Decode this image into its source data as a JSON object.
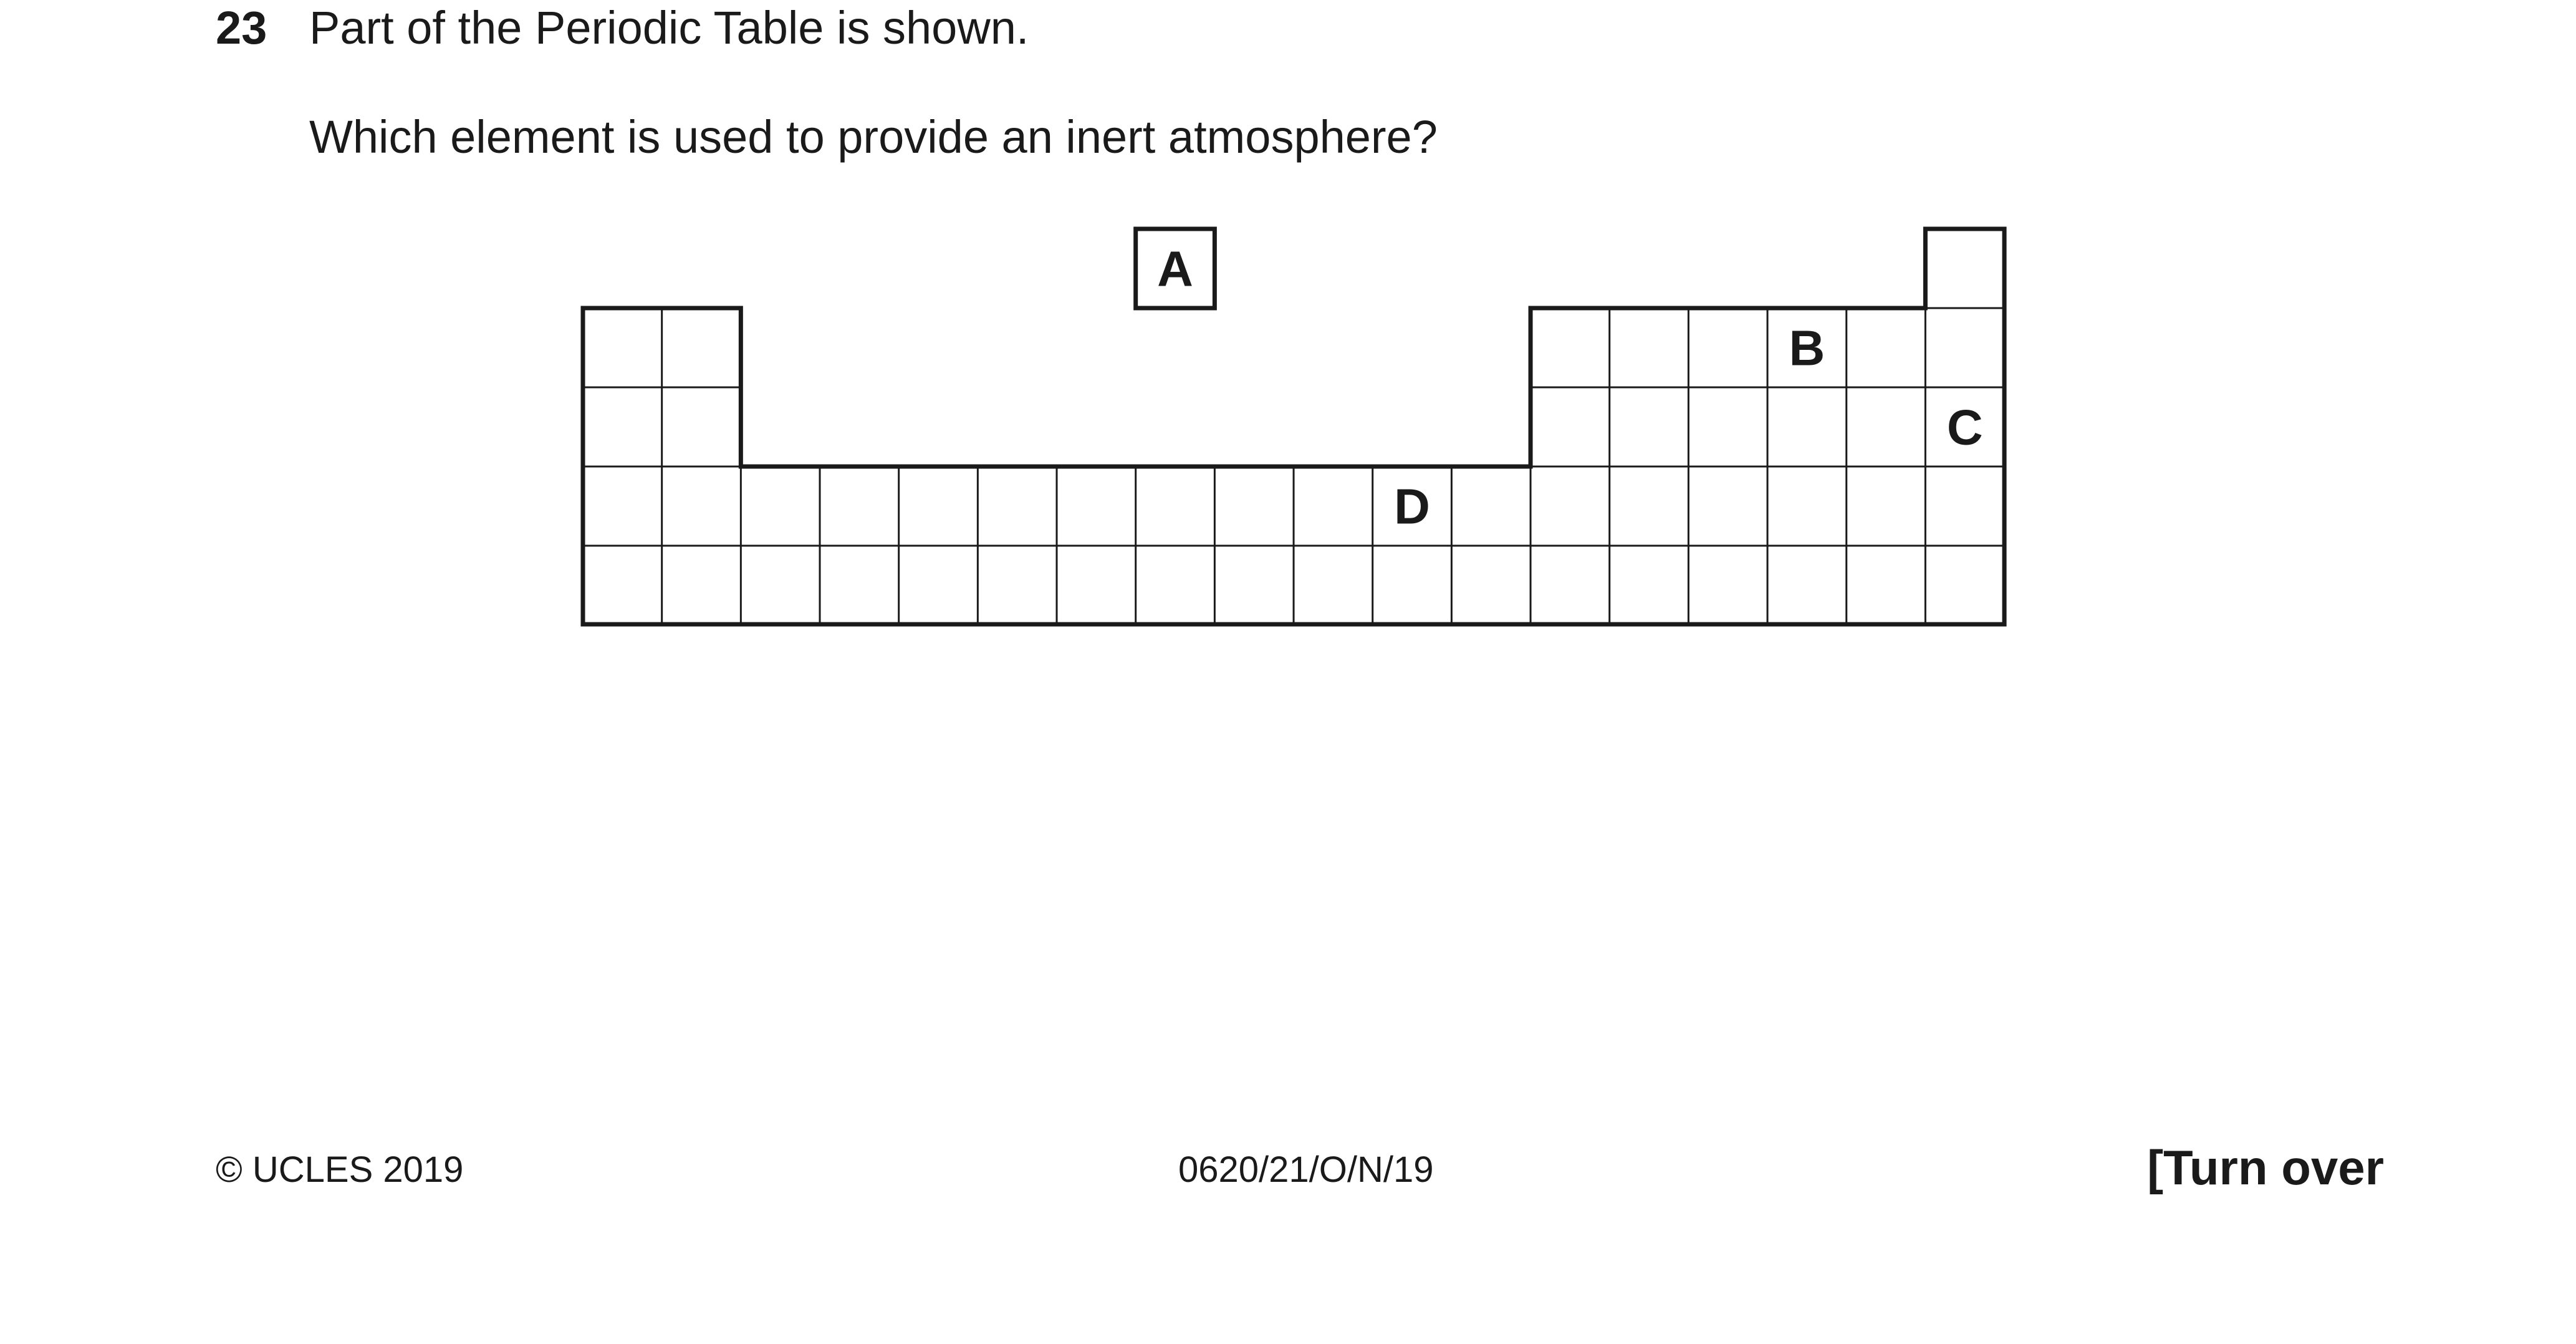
{
  "question": {
    "number": "23",
    "stem": "Part of the Periodic Table is shown.",
    "prompt": "Which element is used to provide an inert atmosphere?"
  },
  "periodic_table": {
    "groups": 18,
    "labelled_cells": [
      {
        "label": "A",
        "period": 1,
        "group": 8,
        "note": "isolated box above table"
      },
      {
        "label": "B",
        "period": 2,
        "group": 16
      },
      {
        "label": "C",
        "period": 3,
        "group": 18
      },
      {
        "label": "D",
        "period": 4,
        "group": 11
      }
    ]
  },
  "footer": {
    "copyright": "© UCLES 2019",
    "paper_code": "0620/21/O/N/19",
    "turn_over": "[Turn over"
  }
}
